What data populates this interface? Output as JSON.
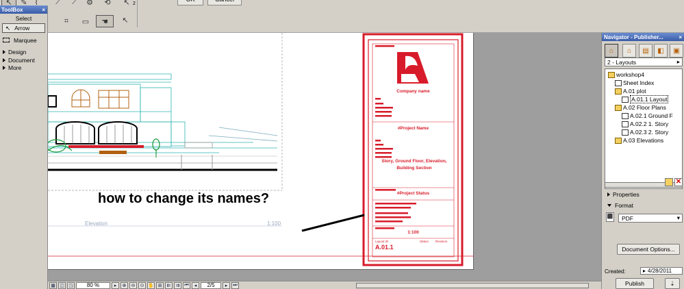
{
  "toolbar": {
    "ok_label": "OK",
    "cancel_label": "Cancel",
    "layer_number": "2"
  },
  "toolbox": {
    "title": "ToolBox",
    "close": "×",
    "select_label": "Select",
    "items": [
      "Arrow",
      "Marquee"
    ],
    "groups": [
      "Design",
      "Document",
      "More"
    ]
  },
  "canvas": {
    "elevation_label": "Elevation",
    "scale_label": "1:100",
    "annotation": "how to change its names?",
    "title_block": {
      "company": "Company name",
      "project_name": "#Project Name",
      "views": "Story, Ground Floor, Elevation, Building Section",
      "project_status": "#Project Status",
      "scale": "1:100",
      "layout_id_label": "Layout ID",
      "status_label": "Status",
      "revision_label": "Revision",
      "layout_id": "A.01.1"
    }
  },
  "statusbar": {
    "zoom": "80 %",
    "page": "2/5"
  },
  "navigator": {
    "title": "Navigator - Publisher...",
    "dropdown": "2 - Layouts",
    "tree": [
      {
        "label": "workshop4",
        "indent": 0,
        "icon": "folder"
      },
      {
        "label": "Sheet Index",
        "indent": 1,
        "icon": "doc"
      },
      {
        "label": "A.01 plot",
        "indent": 1,
        "icon": "folder"
      },
      {
        "label": "A.01.1 Layout",
        "indent": 2,
        "icon": "doc",
        "selected": true
      },
      {
        "label": "A.02 Floor Plans",
        "indent": 1,
        "icon": "folder"
      },
      {
        "label": "A.02.1 Ground F",
        "indent": 2,
        "icon": "doc"
      },
      {
        "label": "A.02.2 1. Story",
        "indent": 2,
        "icon": "doc"
      },
      {
        "label": "A.02.3 2. Story",
        "indent": 2,
        "icon": "doc"
      },
      {
        "label": "A.03 Elevations",
        "indent": 1,
        "icon": "folder"
      }
    ],
    "properties_label": "Properties",
    "format_label": "Format",
    "format_value": "PDF",
    "document_options_label": "Document Options...",
    "created_label": "Created:",
    "created_date": "4/28/2011",
    "publish_label": "Publish"
  },
  "colors": {
    "red": "#d81b2a",
    "cyan": "#2bb5b0",
    "panel": "#d4d0c8"
  }
}
